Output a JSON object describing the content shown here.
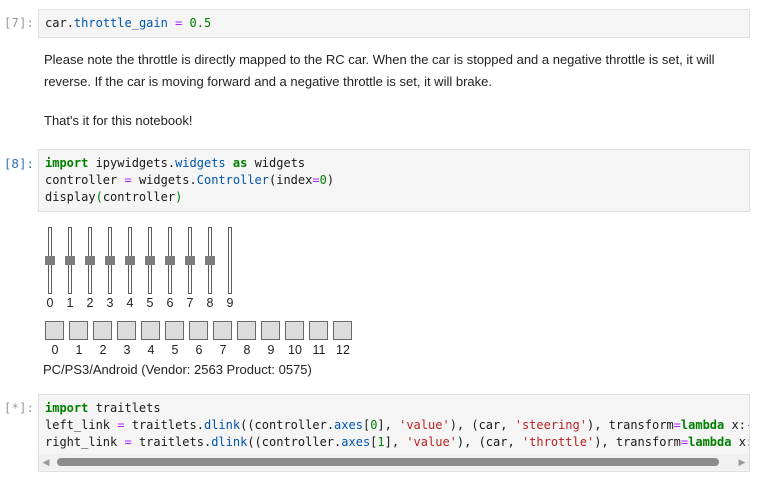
{
  "cells": {
    "c7": {
      "prompt": "[7]:",
      "line1": {
        "obj": "car",
        "dot": ".",
        "attr": "throttle_gain",
        "sp1": " ",
        "op": "=",
        "sp2": " ",
        "num": "0.5"
      }
    },
    "md1": {
      "para1": "Please note the throttle is directly mapped to the RC car. When the car is stopped and a negative throttle is set, it will reverse. If the car is moving forward and a negative throttle is set, it will brake.",
      "para2": "That's it for this notebook!"
    },
    "c8": {
      "prompt": "[8]:",
      "line1": {
        "kw1": "import",
        "mod": " ipywidgets",
        "dot": ".",
        "attr": "widgets",
        "kw2": " as",
        "rest": " widgets"
      },
      "line2": {
        "name": "controller",
        "op": " = ",
        "obj": "widgets",
        "dot": ".",
        "attr": "Controller",
        "open": "(index",
        "eq": "=",
        "num": "0",
        "close": ")"
      },
      "line3": {
        "fn": "display",
        "open": "(",
        "arg": "controller",
        "close": ")"
      }
    },
    "c_star": {
      "prompt": "[*]:",
      "line1": {
        "kw": "import",
        "rest": " traitlets"
      },
      "line2": {
        "a": "left_link",
        "b": " = ",
        "c": "traitlets",
        "d": ".",
        "e": "dlink",
        "f": "((controller",
        "g": ".",
        "h": "axes",
        "i": "[",
        "j": "0",
        "k": "], ",
        "l": "'value'",
        "m": "), (car, ",
        "n": "'steering'",
        "o": "), transform",
        "p": "=",
        "q": "lambda",
        "r": " x:",
        "s": "-x"
      },
      "line3": {
        "a": "right_link",
        "b": " = ",
        "c": "traitlets",
        "d": ".",
        "e": "dlink",
        "f": "((controller",
        "g": ".",
        "h": "axes",
        "i": "[",
        "j": "1",
        "k": "], ",
        "l": "'value'",
        "m": "), (car, ",
        "n": "'throttle'",
        "o": "), transform",
        "p": "=",
        "q": "lambda",
        "r": " x:x"
      }
    }
  },
  "controller": {
    "axis_labels": [
      "0",
      "1",
      "2",
      "3",
      "4",
      "5",
      "6",
      "7",
      "8",
      "9"
    ],
    "axis_values": [
      0,
      0,
      0,
      0,
      0,
      0,
      0,
      0,
      0,
      -1
    ],
    "button_labels": [
      "0",
      "1",
      "2",
      "3",
      "4",
      "5",
      "6",
      "7",
      "8",
      "9",
      "10",
      "11",
      "12"
    ],
    "name": "PC/PS3/Android (Vendor: 2563 Product: 0575)"
  },
  "scrollbar": {
    "left_arrow": "◀",
    "right_arrow": "▶"
  }
}
